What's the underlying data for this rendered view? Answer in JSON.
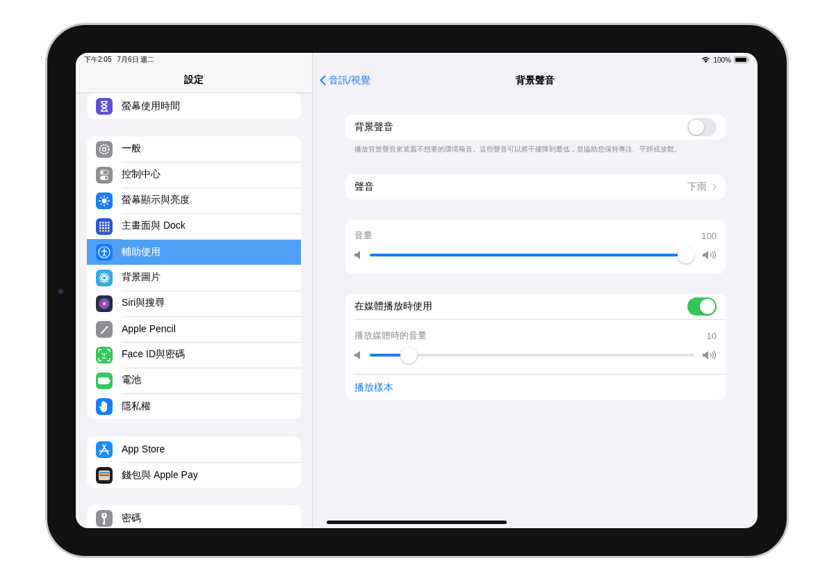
{
  "status_bar": {
    "time": "下午2:05",
    "date": "7月6日 週二",
    "battery": "100%"
  },
  "sidebar": {
    "title": "設定",
    "groups": [
      {
        "items": [
          {
            "label": "螢幕使用時間",
            "color": "#5a4fd6",
            "selected": false
          }
        ]
      },
      {
        "items": [
          {
            "label": "一般",
            "color": "#8e8e93",
            "selected": false
          },
          {
            "label": "控制中心",
            "color": "#8e8e93",
            "selected": false
          },
          {
            "label": "螢幕顯示與亮度",
            "color": "#1a7cf5",
            "selected": false
          },
          {
            "label": "主畫面與 Dock",
            "color": "#2c56d9",
            "selected": false
          },
          {
            "label": "輔助使用",
            "color": "#1a7cf5",
            "selected": true
          },
          {
            "label": "背景圖片",
            "color": "#35aadc",
            "selected": false
          },
          {
            "label": "Siri與搜尋",
            "color": "#2a2a3a",
            "selected": false
          },
          {
            "label": "Apple Pencil",
            "color": "#8e8e93",
            "selected": false
          },
          {
            "label": "Face ID與密碼",
            "color": "#34c759",
            "selected": false
          },
          {
            "label": "電池",
            "color": "#34c759",
            "selected": false
          },
          {
            "label": "隱私權",
            "color": "#1a7cf5",
            "selected": false
          }
        ]
      },
      {
        "items": [
          {
            "label": "App Store",
            "color": "#1a8cf5",
            "selected": false
          },
          {
            "label": "錢包與 Apple Pay",
            "color": "#1c1c1e",
            "selected": false
          }
        ]
      },
      {
        "items": [
          {
            "label": "密碼",
            "color": "#8e8e93",
            "selected": false
          }
        ]
      }
    ]
  },
  "detail": {
    "back": "音訊/視覺",
    "title": "背景聲音",
    "sections": [
      {
        "rows": [
          {
            "kind": "toggle",
            "label": "背景聲音",
            "on": false
          }
        ],
        "footer": "播放背景聲音來遮蓋不想要的環境噪音。這些聲音可以將干擾降到最低，並協助您保持專注、平靜或放鬆。"
      },
      {
        "rows": [
          {
            "kind": "link",
            "label": "聲音",
            "value": "下雨"
          }
        ]
      },
      {
        "rows": [
          {
            "kind": "slider",
            "label": "音量",
            "reading": "100",
            "level": 1
          }
        ]
      },
      {
        "rows": [
          {
            "kind": "toggle",
            "label": "在媒體播放時使用",
            "on": true
          },
          {
            "kind": "slider",
            "label": "播放媒體時的音量",
            "reading": "10",
            "level": 0.1
          },
          {
            "kind": "action",
            "label": "播放樣本"
          }
        ]
      }
    ]
  }
}
